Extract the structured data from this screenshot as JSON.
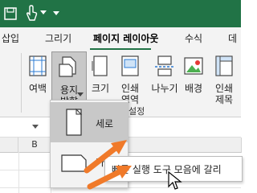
{
  "titlebar": {
    "save_icon": "save-icon",
    "touch_icon": "touch-mode-icon",
    "undo_icon": "undo-icon",
    "redo_icon": "redo-icon",
    "customize_icon": "customize-qat-icon",
    "color": "#217346"
  },
  "tabs": [
    {
      "label": "삽입"
    },
    {
      "label": "그리기"
    },
    {
      "label": "페이지 레이아웃",
      "active": true
    },
    {
      "label": "수식"
    },
    {
      "label": "데"
    }
  ],
  "ribbon": {
    "margins": "여백",
    "orientation": [
      "용지",
      "방향"
    ],
    "size": "크기",
    "print_area": [
      "인쇄",
      "영역"
    ],
    "breaks": "나누기",
    "background": "배경",
    "print_titles": [
      "인쇄",
      "제목"
    ],
    "group_label": "설정"
  },
  "grid": {
    "col_b": "B"
  },
  "orientation_menu": {
    "items": [
      {
        "label": "세로",
        "selected": true
      },
      {
        "label": "가로"
      }
    ]
  },
  "tooltip": {
    "text": "빠른 실행 도구 모음에 갈리"
  }
}
